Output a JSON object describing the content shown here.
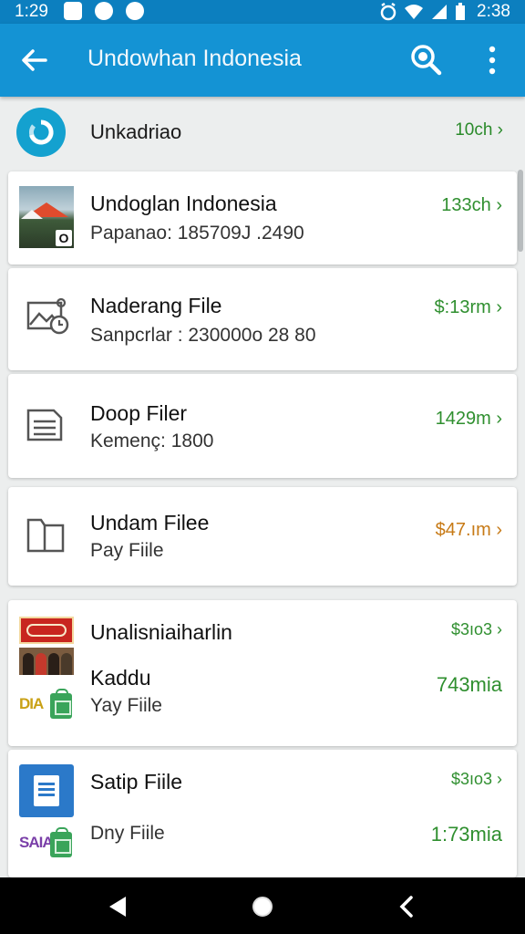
{
  "status_bar": {
    "time_left": "1:29",
    "time_right": "2:38",
    "left_icons": [
      "photo-icon",
      "whatsapp-icon",
      "messenger-icon"
    ],
    "right_icons": [
      "alarm-icon",
      "wifi-icon",
      "signal-icon",
      "battery-icon"
    ]
  },
  "toolbar": {
    "title": "Undowhan Indonesia",
    "back_icon": "arrow-left-icon",
    "search_icon": "search-icon",
    "more_icon": "more-vert-icon"
  },
  "header_row": {
    "label": "Unkadriao",
    "meta": "10ch ›"
  },
  "items": [
    {
      "title": "Undoglan Indonesia",
      "subtitle": "Papanao: 185709J .2490",
      "meta": "133ch ›",
      "thumb_badge": "O"
    },
    {
      "title": "Naderang File",
      "subtitle": "Sanpcrlar : 230000o 28 80",
      "meta": "$:13rm ›"
    },
    {
      "title": "Doop Filer",
      "subtitle": "Kemenç: 1800",
      "meta": "1429m ›"
    },
    {
      "title": "Undam Filee",
      "subtitle": "Pay Fiile",
      "meta": "$47.ım ›"
    },
    {
      "title": "Unalisniaiharlin",
      "highlight": "Kaddu",
      "subtitle": "Yay Fiile",
      "meta_top": "$3ıo3 ›",
      "meta_bottom": "743mia",
      "logo_text": "DIA"
    },
    {
      "title": "Satip Fiile",
      "subtitle": "Dny Fiile",
      "meta_top": "$3ıo3 ›",
      "meta_bottom": "1:73mia",
      "logo_text": "SAIA"
    }
  ],
  "colors": {
    "status_bar": "#0c7fbf",
    "toolbar": "#1493d4",
    "meta_green": "#2f8f2f",
    "meta_orange": "#c77a16"
  }
}
